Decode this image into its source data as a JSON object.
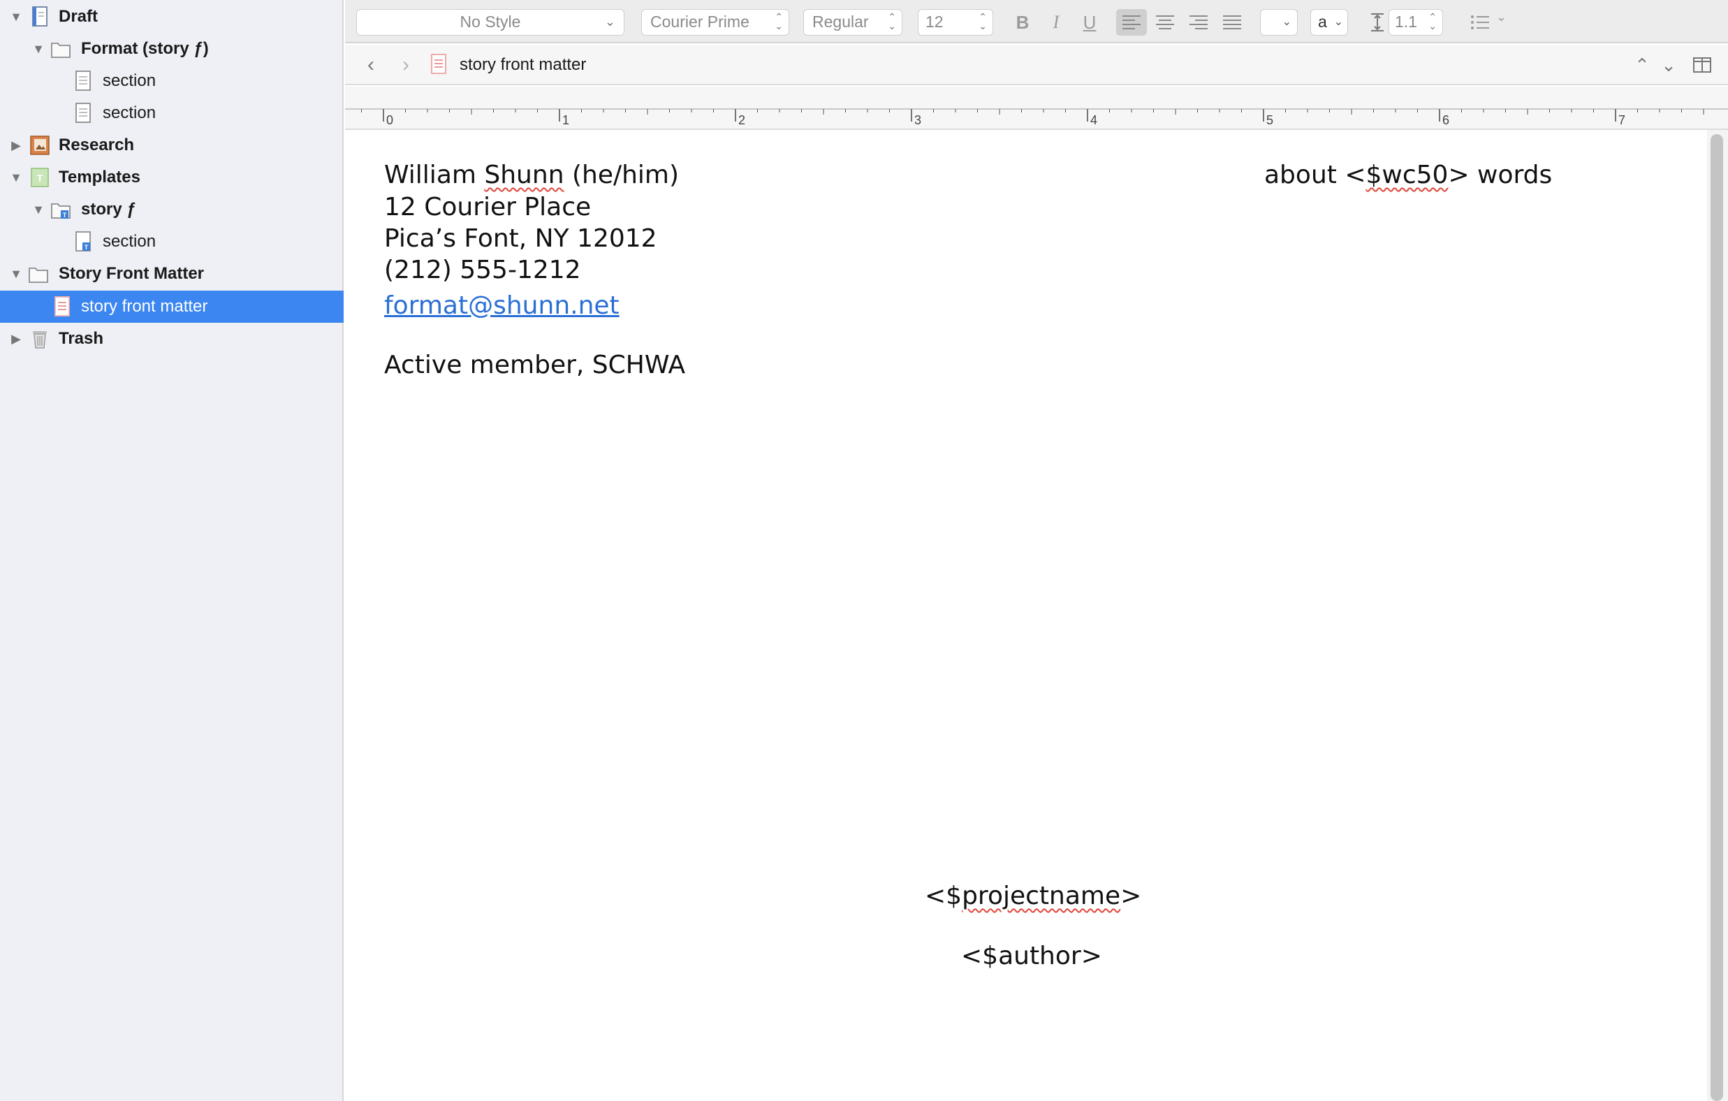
{
  "binder": {
    "items": [
      {
        "label": "Draft",
        "bold": true,
        "expanded": true,
        "icon": "draft-document-icon",
        "level": 0
      },
      {
        "label": "Format (story ƒ)",
        "bold": true,
        "expanded": true,
        "icon": "folder-icon",
        "level": 1
      },
      {
        "label": "section",
        "bold": false,
        "icon": "document-icon",
        "level": 2
      },
      {
        "label": "section",
        "bold": false,
        "icon": "document-icon",
        "level": 2
      },
      {
        "label": "Research",
        "bold": true,
        "expanded": false,
        "icon": "research-folder-icon",
        "level": 0
      },
      {
        "label": "Templates",
        "bold": true,
        "expanded": true,
        "icon": "templates-folder-icon",
        "level": 0
      },
      {
        "label": "story ƒ",
        "bold": true,
        "expanded": true,
        "icon": "template-folder-icon",
        "level": 1
      },
      {
        "label": "section",
        "bold": false,
        "icon": "template-document-icon",
        "level": 2
      },
      {
        "label": "Story Front Matter",
        "bold": true,
        "expanded": true,
        "icon": "folder-icon",
        "level": 0
      },
      {
        "label": "story front matter",
        "bold": false,
        "icon": "front-matter-document-icon",
        "level": 1,
        "selected": true
      },
      {
        "label": "Trash",
        "bold": true,
        "expanded": false,
        "icon": "trash-icon",
        "level": 0
      }
    ]
  },
  "format_bar": {
    "style": "No Style",
    "font": "Courier Prime",
    "weight": "Regular",
    "size": "12",
    "bold": "B",
    "italic": "I",
    "underline": "U",
    "text_color_label": "a",
    "line_spacing": "1.1"
  },
  "header": {
    "title": "story front matter"
  },
  "ruler": {
    "labels": [
      "0",
      "1",
      "2",
      "3",
      "4",
      "5",
      "6",
      "7"
    ]
  },
  "document": {
    "name_prefix": "William ",
    "name_surname": "Shunn",
    "name_suffix": " (he/him)",
    "address1": "12 Courier Place",
    "address2": "Pica’s Font, NY 12012",
    "phone": "(212) 555-1212",
    "email": "format@shunn.net",
    "membership": "Active member, SCHWA",
    "wordcount_prefix": "about <",
    "wordcount_tag": "$wc50",
    "wordcount_suffix": "> words",
    "projectname_prefix": "<$",
    "projectname_tag": "projectname",
    "projectname_suffix": ">",
    "author": "<$author>"
  },
  "colors": {
    "selection": "#3b86f0",
    "sidebar_bg": "#eef0f5",
    "link": "#2a6fd6"
  }
}
